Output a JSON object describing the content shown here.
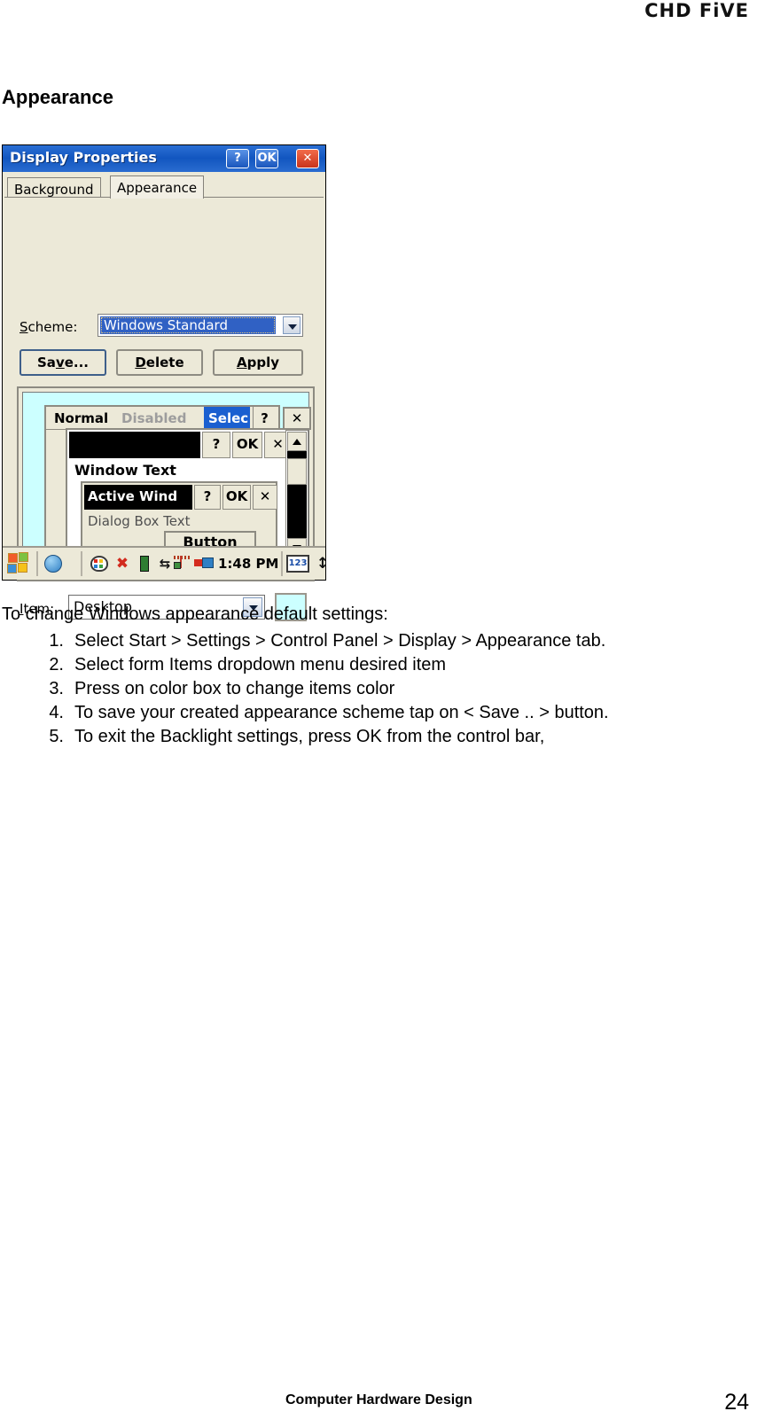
{
  "header": {
    "brand": "CHD FiVE"
  },
  "section": {
    "title": "Appearance"
  },
  "screenshot": {
    "dialog": {
      "title": "Display Properties",
      "titlebar_buttons": {
        "help": "?",
        "ok": "OK",
        "close": "✕"
      },
      "tabs": [
        {
          "label": "Background",
          "selected": false
        },
        {
          "label": "Appearance",
          "selected": true
        }
      ],
      "scheme": {
        "label": "Scheme:",
        "label_accel": "S",
        "label_rest": "cheme:",
        "value": "Windows Standard",
        "dropdown_icon": "chevron-down-icon"
      },
      "buttons": {
        "save": "Save...",
        "save_accel": "v",
        "delete": "Delete",
        "delete_accel": "D",
        "apply": "Apply",
        "apply_accel": "A"
      },
      "preview": {
        "desktop_color": "#ccffff",
        "menubar": {
          "normal": "Normal",
          "disabled": "Disabled",
          "selected": "Selec",
          "help": "?",
          "close": "✕"
        },
        "outer_close": "✕",
        "window": {
          "caption_buttons": {
            "help": "?",
            "ok": "OK",
            "close": "✕"
          },
          "window_text": "Window Text"
        },
        "dialog": {
          "caption": "Active Wind",
          "caption_buttons": {
            "help": "?",
            "ok": "OK",
            "close": "✕"
          },
          "dialog_text": "Dialog Box Text",
          "button": "Button"
        },
        "scrollbar": {
          "up": "up-arrow-icon",
          "down": "down-arrow-icon"
        }
      },
      "item": {
        "label": "Item:",
        "label_accel": "I",
        "label_rest": "tem:",
        "value": "Desktop",
        "dropdown_icon": "chevron-down-icon",
        "color_swatch": "#ccffff"
      }
    },
    "taskbar": {
      "start_icon": "windows-flag-icon",
      "icons": [
        "globe-icon",
        "palette-icon",
        "close-x-icon",
        "battery-icon",
        "sync-arrows-icon",
        "signal-icon",
        "plug-icon"
      ],
      "clock": "1:48 PM",
      "tray_icons": [
        "keyboard-icon",
        "up-down-arrow-icon"
      ]
    }
  },
  "body": {
    "intro": "To change Windows appearance default settings:",
    "steps": [
      {
        "num": "1.",
        "text": "Select Start > Settings > Control Panel > Display > Appearance tab."
      },
      {
        "num": "2.",
        "text": "Select form Items dropdown menu desired item"
      },
      {
        "num": "3.",
        "text": "Press on color box to change items color"
      },
      {
        "num": "4.",
        "text": "To save your created appearance scheme tap on < Save .. > button."
      },
      {
        "num": "5.",
        "text": "To exit the Backlight settings, press OK from the control bar,"
      }
    ]
  },
  "footer": {
    "title": "Computer Hardware Design",
    "page": "24"
  }
}
